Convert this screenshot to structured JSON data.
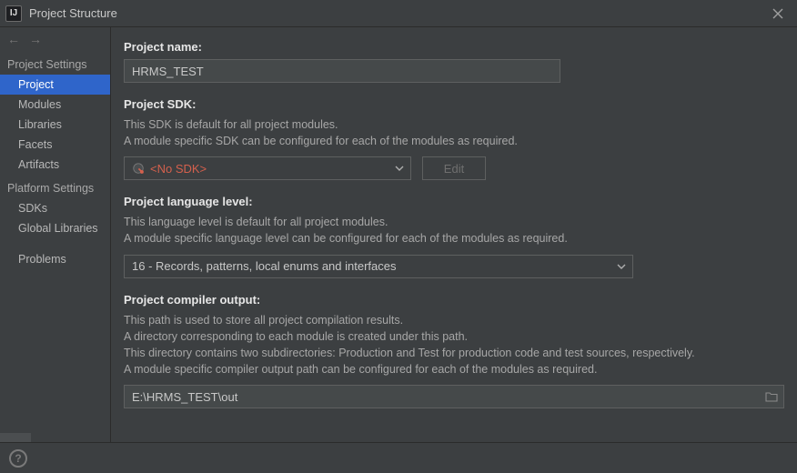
{
  "window": {
    "title": "Project Structure",
    "app_icon_letter": "IJ"
  },
  "sidebar": {
    "sections": [
      {
        "title": "Project Settings",
        "items": [
          {
            "label": "Project",
            "selected": true
          },
          {
            "label": "Modules",
            "selected": false
          },
          {
            "label": "Libraries",
            "selected": false
          },
          {
            "label": "Facets",
            "selected": false
          },
          {
            "label": "Artifacts",
            "selected": false
          }
        ]
      },
      {
        "title": "Platform Settings",
        "items": [
          {
            "label": "SDKs",
            "selected": false
          },
          {
            "label": "Global Libraries",
            "selected": false
          }
        ]
      }
    ],
    "standalone": [
      {
        "label": "Problems",
        "selected": false
      }
    ]
  },
  "main": {
    "project_name_label": "Project name:",
    "project_name_value": "HRMS_TEST",
    "sdk_label": "Project SDK:",
    "sdk_desc1": "This SDK is default for all project modules.",
    "sdk_desc2": "A module specific SDK can be configured for each of the modules as required.",
    "sdk_value": "<No SDK>",
    "edit_button": "Edit",
    "lang_label": "Project language level:",
    "lang_desc1": "This language level is default for all project modules.",
    "lang_desc2": "A module specific language level can be configured for each of the modules as required.",
    "lang_value": "16 - Records, patterns, local enums and interfaces",
    "out_label": "Project compiler output:",
    "out_desc1": "This path is used to store all project compilation results.",
    "out_desc2": "A directory corresponding to each module is created under this path.",
    "out_desc3": "This directory contains two subdirectories: Production and Test for production code and test sources, respectively.",
    "out_desc4": "A module specific compiler output path can be configured for each of the modules as required.",
    "out_value": "E:\\HRMS_TEST\\out"
  }
}
